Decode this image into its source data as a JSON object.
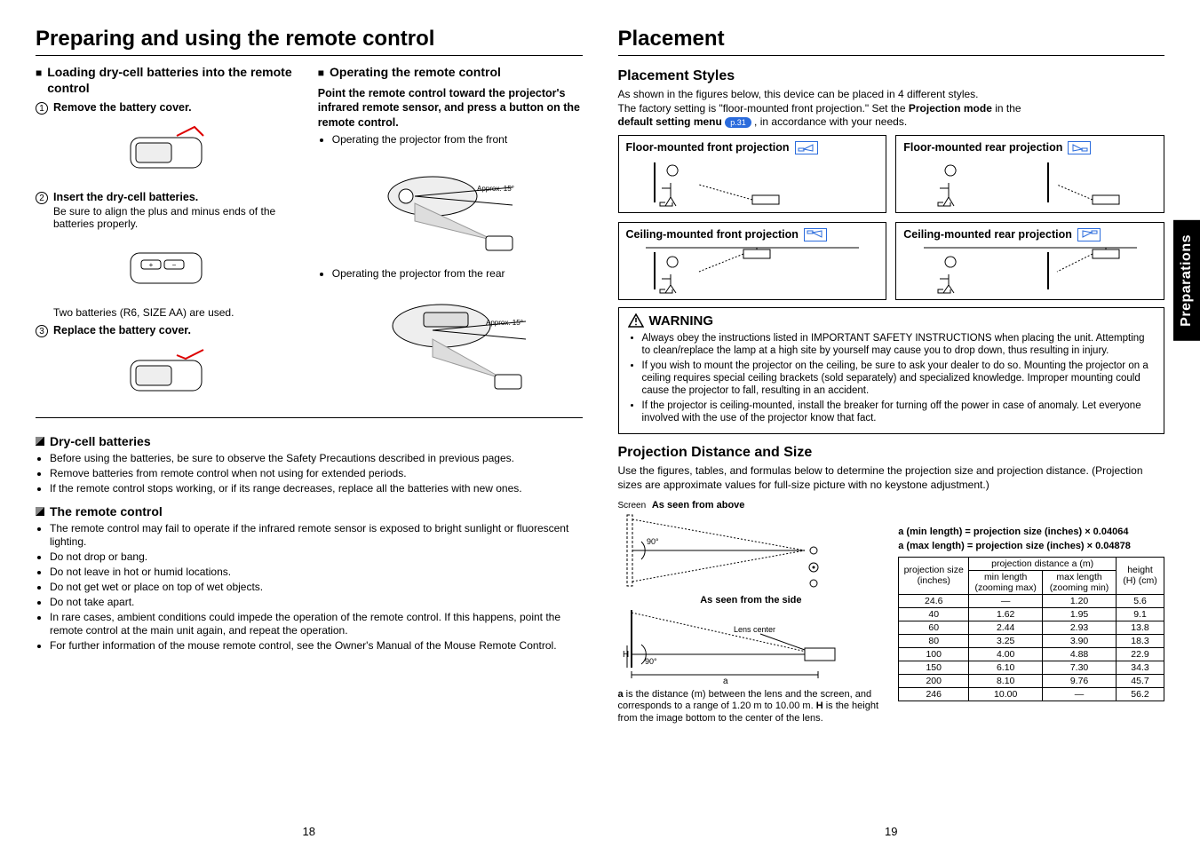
{
  "sidetab": "Preparations",
  "left": {
    "title": "Preparing and using the remote control",
    "load_heading": "Loading dry-cell batteries into the remote control",
    "steps": [
      {
        "n": "1",
        "text": "Remove the battery cover."
      },
      {
        "n": "2",
        "text": "Insert the dry-cell batteries.",
        "detail": "Be sure to align the plus and minus ends of the batteries properly."
      },
      {
        "n": "3",
        "text": "Replace the battery cover."
      }
    ],
    "battnote": "Two batteries (R6, SIZE AA) are used.",
    "operate_heading": "Operating the remote control",
    "operate_lead": "Point the remote control toward the projector's infrared remote sensor, and press a button on the remote control.",
    "operate_front": "Operating the projector from the front",
    "operate_rear": "Operating the projector from the rear",
    "approx": "Approx. 15°",
    "note_batt_head": "Dry-cell batteries",
    "note_batt_items": [
      "Before using the batteries, be sure to observe the Safety Precautions described in previous pages.",
      "Remove batteries from remote control when not using for extended periods.",
      "If the remote control stops working, or if its range decreases, replace all the batteries with new ones."
    ],
    "note_rc_head": "The remote control",
    "note_rc_items": [
      "The remote control may fail to operate if the infrared remote sensor is exposed to bright sunlight or fluorescent lighting.",
      "Do not drop or bang.",
      "Do not leave in hot or humid locations.",
      "Do not get wet or place on top of wet objects.",
      "Do not take apart.",
      "In rare cases, ambient conditions could impede the operation of the remote control. If this happens, point the remote control at the main unit again, and repeat the operation.",
      "For further information of the mouse remote control, see the Owner's Manual of the Mouse Remote Control."
    ],
    "pagenum": "18"
  },
  "right": {
    "title": "Placement",
    "styles_head": "Placement Styles",
    "styles_para_a": "As shown in the figures below, this device can be placed in 4 different styles.",
    "styles_para_b1": "The factory setting is \"floor-mounted front projection.\" Set the ",
    "styles_para_b_strong": "Projection mode",
    "styles_para_b2": " in the ",
    "styles_para_c_strong": "default setting menu ",
    "pageref": "p.31",
    "styles_para_c2": " , in accordance with your needs.",
    "placement_boxes": [
      "Floor-mounted front projection",
      "Floor-mounted rear projection",
      "Ceiling-mounted front projection",
      "Ceiling-mounted rear projection"
    ],
    "warn_head": "WARNING",
    "warn_items": [
      "Always obey the instructions listed in IMPORTANT SAFETY INSTRUCTIONS when placing the unit. Attempting to clean/replace the lamp at a high site by yourself may cause you to drop down, thus resulting in injury.",
      "If you wish to mount the projector on the ceiling, be sure to ask your dealer to do so. Mounting the projector on a ceiling requires special ceiling brackets (sold separately) and specialized knowledge. Improper mounting could cause the projector to fall, resulting in an accident.",
      "If the projector is ceiling-mounted, install the breaker for turning off the power in case of anomaly. Let everyone involved with the use of the projector know that fact."
    ],
    "dist_head": "Projection Distance and Size",
    "dist_para": "Use the figures, tables, and formulas below to determine the projection size and projection distance. (Projection sizes are approximate values for full-size picture with no keystone adjustment.)",
    "screen_label": "Screen",
    "asabove": "As seen from above",
    "asside": "As seen from the side",
    "lens_center": "Lens center",
    "ninety": "90°",
    "H": "H",
    "a": "a",
    "caption": "a is the distance (m) between the lens and the screen, and corresponds to a range of 1.20 m to 10.00 m. H is the height from the image bottom to the center of the lens.",
    "caption_bold_a": "a",
    "caption_bold_H": "H",
    "formula_min": "a (min length) = projection size (inches) × 0.04064",
    "formula_max": "a (max length) = projection size (inches) × 0.04878",
    "table_h1": "projection size (inches)",
    "table_h2": "projection distance a (m)",
    "table_h2a": "min length (zooming max)",
    "table_h2b": "max length (zooming min)",
    "table_h3": "height (H) (cm)",
    "chart_data": {
      "type": "table",
      "columns": [
        "projection size (inches)",
        "min length (zooming max)",
        "max length (zooming min)",
        "height (H) (cm)"
      ],
      "rows": [
        [
          "24.6",
          "—",
          "1.20",
          "5.6"
        ],
        [
          "40",
          "1.62",
          "1.95",
          "9.1"
        ],
        [
          "60",
          "2.44",
          "2.93",
          "13.8"
        ],
        [
          "80",
          "3.25",
          "3.90",
          "18.3"
        ],
        [
          "100",
          "4.00",
          "4.88",
          "22.9"
        ],
        [
          "150",
          "6.10",
          "7.30",
          "34.3"
        ],
        [
          "200",
          "8.10",
          "9.76",
          "45.7"
        ],
        [
          "246",
          "10.00",
          "—",
          "56.2"
        ]
      ]
    },
    "pagenum": "19"
  }
}
